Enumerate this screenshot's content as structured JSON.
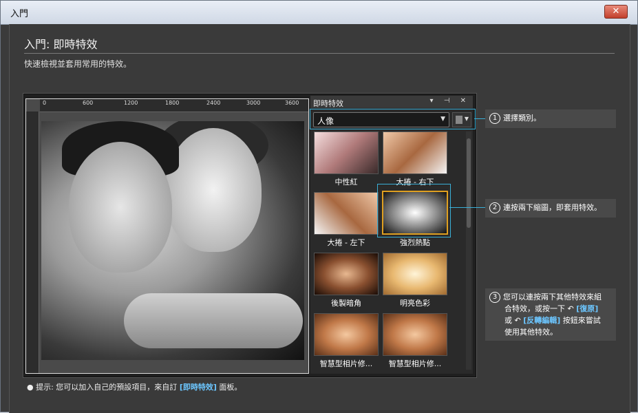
{
  "window": {
    "title": "入門",
    "close_label": "✕"
  },
  "header": {
    "heading": "入門: 即時特效",
    "subtitle": "快速檢視並套用常用的特效。"
  },
  "ruler": {
    "labels": [
      "0",
      "600",
      "1200",
      "1800",
      "2400",
      "3000",
      "3600"
    ]
  },
  "fx_panel": {
    "title": "即時特效",
    "controls": "▾ ⊣ ✕",
    "category": "人像",
    "thumbnails": [
      {
        "label": "中性紅"
      },
      {
        "label": "大捲 - 右下"
      },
      {
        "label": "大捲 - 左下"
      },
      {
        "label": "強烈熱點"
      },
      {
        "label": "後製暗角"
      },
      {
        "label": "明亮色彩"
      },
      {
        "label": "智慧型相片修..."
      },
      {
        "label": "智慧型相片修..."
      }
    ]
  },
  "notes": {
    "n1_num": "1",
    "n1_text": "選擇類別。",
    "n2_num": "2",
    "n2_text": "連按兩下縮圖，即套用特效。",
    "n3_num": "3",
    "n3_line1": "您可以連按兩下其他特效來組",
    "n3_line2": "合特效，或按一下",
    "n3_undo": "[復原]",
    "n3_line3a": "或",
    "n3_redo": "[反轉編輯]",
    "n3_line3b": "按鈕來嘗試",
    "n3_line4": "使用其他特效。"
  },
  "tip": {
    "prefix": "提示: 您可以加入自己的預設項目，來自訂",
    "link": "[即時特效]",
    "suffix": "面板。"
  }
}
